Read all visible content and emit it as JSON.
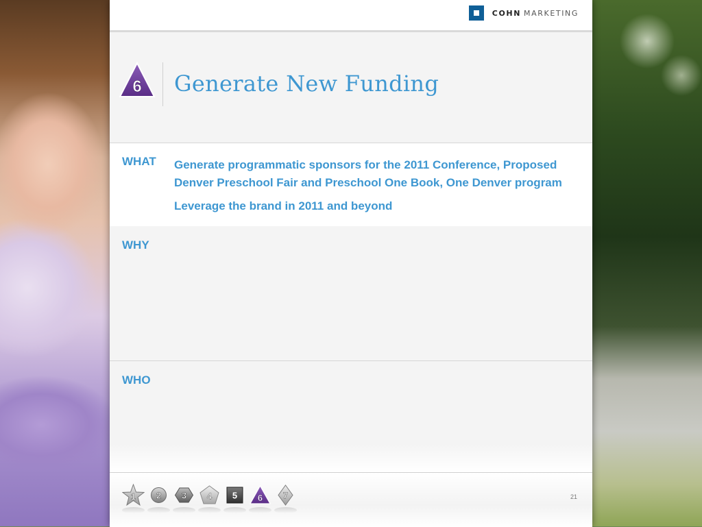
{
  "brand": {
    "name": "COHN",
    "suffix": "MARKETING",
    "color": "#0f5f97"
  },
  "header": {
    "icon": "purple-triangle-6-icon",
    "icon_number": "6",
    "title": "Generate New Funding"
  },
  "sections": {
    "what": {
      "label": "WHAT",
      "lines": [
        "Generate programmatic sponsors for the 2011 Conference, Proposed Denver Preschool Fair and Preschool One Book, One Denver program",
        "Leverage the brand in 2011 and beyond"
      ]
    },
    "why": {
      "label": "WHY"
    },
    "who": {
      "label": "WHO"
    }
  },
  "footer": {
    "nav": [
      {
        "number": "1",
        "shape": "star-icon"
      },
      {
        "number": "2",
        "shape": "circle-icon"
      },
      {
        "number": "3",
        "shape": "hexagon-icon"
      },
      {
        "number": "4",
        "shape": "pentagon-icon"
      },
      {
        "number": "5",
        "shape": "square-icon"
      },
      {
        "number": "6",
        "shape": "triangle-icon",
        "active": true
      },
      {
        "number": "7",
        "shape": "diamond-icon"
      }
    ],
    "page_number": "21"
  },
  "colors": {
    "accent": "#3e97d1",
    "active_icon": "#6c3f96"
  }
}
